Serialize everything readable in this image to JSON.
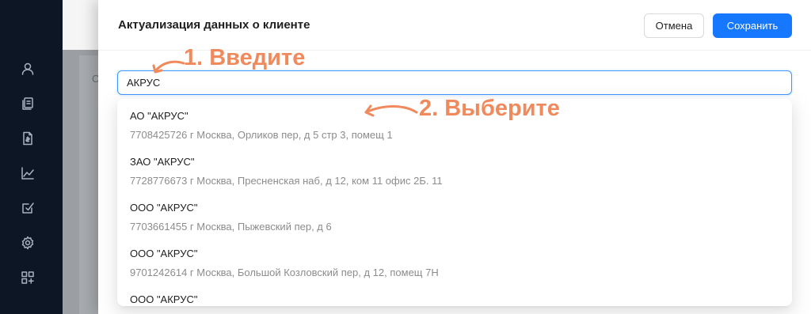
{
  "sidebar": {
    "icons": [
      "user-icon",
      "documents-icon",
      "file-money-icon",
      "chart-line-icon",
      "edit-checkbox-icon",
      "gear-icon",
      "grid-add-icon"
    ]
  },
  "background": {
    "glyph": "С"
  },
  "drawer": {
    "title": "Актуализация данных о клиенте",
    "cancel_label": "Отмена",
    "save_label": "Сохранить",
    "search_value": "АКРУС"
  },
  "options": [
    {
      "name": "АО \"АКРУС\"",
      "address": "7708425726 г Москва, Орликов пер, д 5 стр 3, помещ 1"
    },
    {
      "name": "ЗАО \"АКРУС\"",
      "address": "7728776673 г Москва, Пресненская наб, д 12, ком 11 офис 2Б. 11"
    },
    {
      "name": "ООО \"АКРУС\"",
      "address": "7703661455 г Москва, Пыжевский пер, д 6"
    },
    {
      "name": "ООО \"АКРУС\"",
      "address": "9701242614 г Москва, Большой Козловский пер, д 12, помещ 7Н"
    },
    {
      "name": "ООО \"АКРУС\"",
      "address": ""
    }
  ],
  "annotations": {
    "step1": "1. Введите",
    "step2": "2. Выберите",
    "color": "#f08a5d"
  },
  "colors": {
    "primary": "#1677ff",
    "sidebar": "#0c1624"
  }
}
